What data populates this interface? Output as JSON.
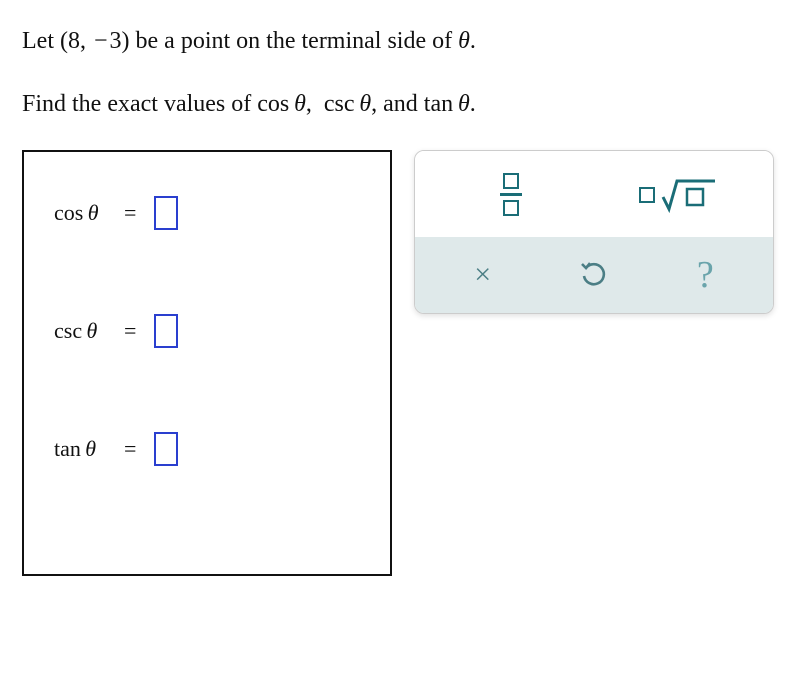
{
  "problem": {
    "sentence1_pre": "Let ",
    "point_open": "(",
    "point_x": "8",
    "point_comma": ", ",
    "point_minus": "−",
    "point_y": "3",
    "point_close": ")",
    "sentence1_post": " be a point on the terminal side of ",
    "theta1": "θ",
    "sentence1_end": ".",
    "sentence2_pre": "Find the exact values of ",
    "fn1": "cos",
    "theta2": "θ",
    "list_sep1": ", ",
    "fn2": "csc",
    "theta3": "θ",
    "list_sep2": ", and ",
    "fn3": "tan",
    "theta4": "θ",
    "sentence2_end": "."
  },
  "answers": [
    {
      "label": "cos",
      "theta": "θ",
      "equals": "="
    },
    {
      "label": "csc",
      "theta": "θ",
      "equals": "="
    },
    {
      "label": "tan",
      "theta": "θ",
      "equals": "="
    }
  ],
  "tools": {
    "fraction": "fraction-template",
    "radical": "radical-template",
    "close": "×",
    "undo": "↻",
    "help": "?"
  }
}
